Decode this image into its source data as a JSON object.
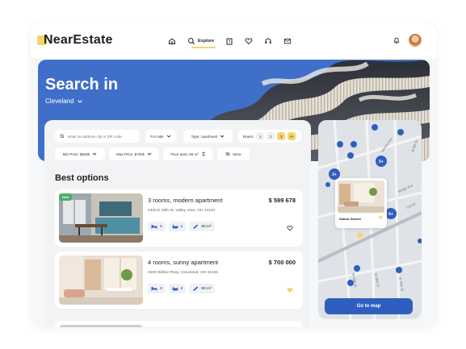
{
  "header": {
    "logo": "NearEstate",
    "nav": [
      {
        "icon": "home-icon",
        "label": ""
      },
      {
        "icon": "search-icon",
        "label": "Explore"
      },
      {
        "icon": "building-icon",
        "label": ""
      },
      {
        "icon": "heart-icon",
        "label": ""
      },
      {
        "icon": "headset-icon",
        "label": ""
      },
      {
        "icon": "mail-icon",
        "label": ""
      }
    ],
    "notification_icon": "bell-icon",
    "avatar_icon": "user-avatar"
  },
  "hero": {
    "title": "Search in",
    "city": "Cleveland"
  },
  "filters": {
    "search_placeholder": "Enter an address city or ZIP code",
    "for_sale": "For sale",
    "type": "Type: Apartment",
    "room_label": "Room:",
    "rooms": [
      "1",
      "2",
      "3",
      "4+"
    ],
    "selected_rooms": [
      "3",
      "4+"
    ],
    "min_price": "Min Price: $500k",
    "max_price": "Max Price: $700k",
    "floor_area": "Floor area: 60 m²",
    "more": "More"
  },
  "section_title": "Best options",
  "listings": [
    {
      "badge": "New",
      "title": "3 rooms, modern apartment",
      "price": "$ 599 678",
      "address": "4300 E 49th St, Valley View, OH 44125",
      "beds": "2",
      "baths": "1",
      "area": "60 m²",
      "favorited": false
    },
    {
      "badge": "",
      "title": "4 rooms, sunny apartment",
      "price": "$ 700 000",
      "address": "4560 Willow Pkwy, Cleveland, OH 44125",
      "beds": "3",
      "baths": "2",
      "area": "60 m²",
      "favorited": true
    }
  ],
  "map": {
    "popup_label": "Sabha Garden",
    "clusters": [
      "3+",
      "5+",
      "6+"
    ],
    "cta": "Go to map",
    "streets": [
      "Wesley Ave",
      "W 8th St",
      "Bridge Ave",
      "Carroll",
      "W 28th St",
      "W 26th St",
      "W 25th St"
    ]
  },
  "colors": {
    "accent_yellow": "#f3d56a",
    "brand_blue": "#2e5fbf",
    "new_green": "#4caf66"
  }
}
